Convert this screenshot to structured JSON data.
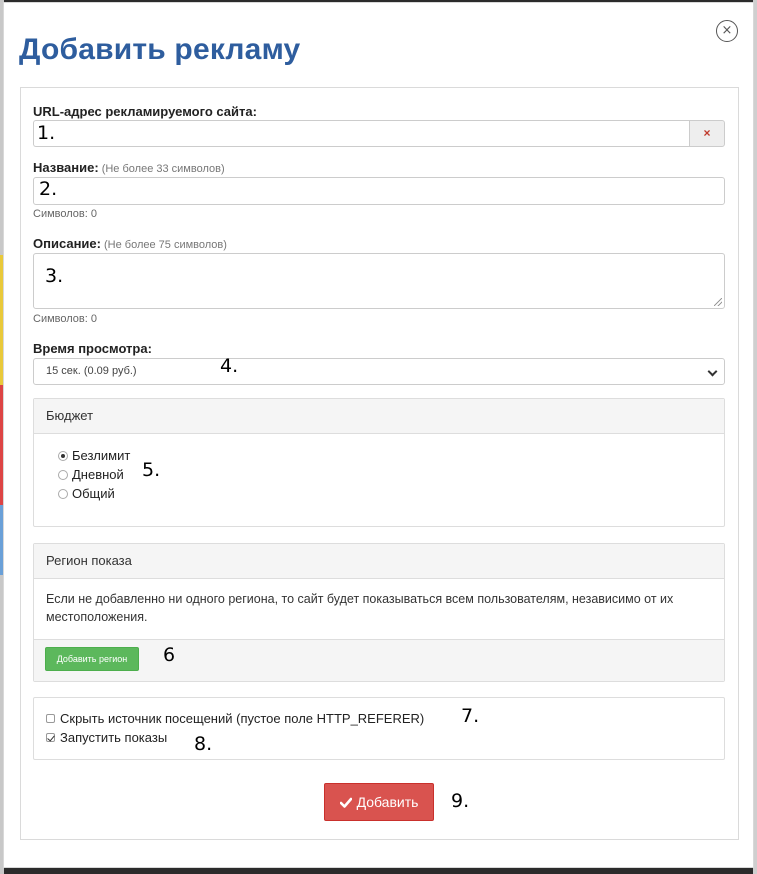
{
  "dialog": {
    "title": "Добавить рекламу",
    "close_icon": "×"
  },
  "url_field": {
    "label": "URL-адрес рекламируемого сайта:",
    "value": "",
    "clear_icon": "×",
    "marker": "1."
  },
  "name_field": {
    "label": "Название:",
    "hint": "(Не более 33 символов)",
    "value": "",
    "counter": "Символов: 0",
    "marker": "2."
  },
  "description_field": {
    "label": "Описание:",
    "hint": "(Не более 75 символов)",
    "value": "",
    "counter": "Символов: 0",
    "marker": "3."
  },
  "view_time": {
    "label": "Время просмотра:",
    "selected": "15 сек. (0.09 руб.)",
    "marker": "4."
  },
  "budget": {
    "header": "Бюджет",
    "options": [
      {
        "label": "Безлимит",
        "checked": true
      },
      {
        "label": "Дневной",
        "checked": false
      },
      {
        "label": "Общий",
        "checked": false
      }
    ],
    "marker": "5."
  },
  "region": {
    "header": "Регион показа",
    "info": "Если не добавленно ни одного региона, то сайт будет показываться всем пользователям, независимо от их местоположения.",
    "add_button": "Добавить регион",
    "marker": "6"
  },
  "options": {
    "hide_referer": {
      "label": "Скрыть источник посещений (пустое поле HTTP_REFERER)",
      "checked": false,
      "marker": "7."
    },
    "start_shows": {
      "label": "Запустить показы",
      "checked": true,
      "marker": "8."
    }
  },
  "submit": {
    "label": "Добавить",
    "icon": "checkmark-icon",
    "marker": "9."
  },
  "colors": {
    "title": "#2e5d9e",
    "success": "#5cb85c",
    "danger": "#d9534f"
  }
}
